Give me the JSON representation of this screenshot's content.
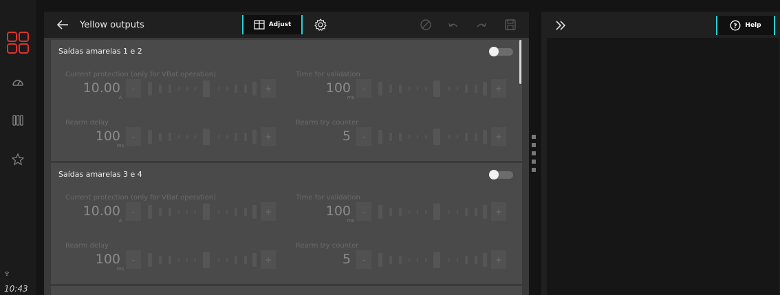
{
  "header": {
    "title": "Yellow outputs",
    "adjust_label": "Adjust",
    "help_label": "Help"
  },
  "sidebar": {
    "time": "10:43",
    "icons": [
      "apps-grid-icon",
      "dashboard-gauge-icon",
      "columns-icon",
      "star-icon"
    ],
    "accent_color": "#e0322e"
  },
  "groups": [
    {
      "title": "Saídas amarelas 1 e 2",
      "enabled": false,
      "params": [
        {
          "label": "Current protection (only for VBat operation)",
          "value": "10.00",
          "unit": "A"
        },
        {
          "label": "Time for validation",
          "value": "100",
          "unit": "ms"
        },
        {
          "label": "Rearm delay",
          "value": "100",
          "unit": "ms"
        },
        {
          "label": "Rearm try counter",
          "value": "5",
          "unit": ""
        }
      ]
    },
    {
      "title": "Saídas amarelas 3 e 4",
      "enabled": false,
      "params": [
        {
          "label": "Current protection (only for VBat operation)",
          "value": "10.00",
          "unit": "A"
        },
        {
          "label": "Time for validation",
          "value": "100",
          "unit": "ms"
        },
        {
          "label": "Rearm delay",
          "value": "100",
          "unit": "ms"
        },
        {
          "label": "Rearm try counter",
          "value": "5",
          "unit": ""
        }
      ]
    }
  ],
  "stepper": {
    "minus": "-",
    "plus": "+"
  },
  "colors": {
    "accent": "#2ad1d1",
    "brand": "#e0322e"
  }
}
